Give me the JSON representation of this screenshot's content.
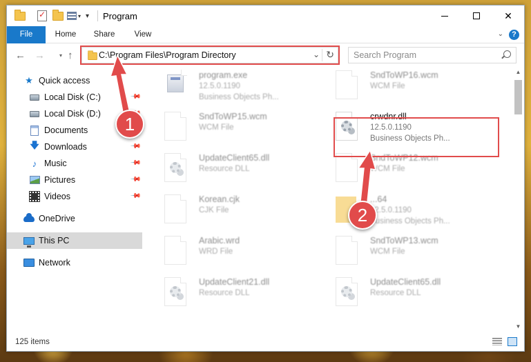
{
  "window": {
    "title": "Program",
    "minimize_glyph": "",
    "maximize_glyph": "",
    "close_glyph": "✕"
  },
  "ribbon": {
    "tabs": [
      "File",
      "Home",
      "Share",
      "View"
    ],
    "help": "?"
  },
  "navigation": {
    "back": "←",
    "forward": "→",
    "up": "↑",
    "address": "C:\\Program Files\\Program Directory",
    "search_placeholder": "Search Program"
  },
  "sidebar": {
    "items": [
      {
        "label": "Quick access",
        "icon": "star-icon",
        "pinned": false
      },
      {
        "label": "Local Disk (C:)",
        "icon": "disk-icon",
        "pinned": true
      },
      {
        "label": "Local Disk (D:)",
        "icon": "disk-icon",
        "pinned": true
      },
      {
        "label": "Documents",
        "icon": "documents-icon",
        "pinned": true
      },
      {
        "label": "Downloads",
        "icon": "download-icon",
        "pinned": true
      },
      {
        "label": "Music",
        "icon": "music-icon",
        "pinned": true
      },
      {
        "label": "Pictures",
        "icon": "pictures-icon",
        "pinned": true
      },
      {
        "label": "Videos",
        "icon": "videos-icon",
        "pinned": true
      },
      {
        "label": "OneDrive",
        "icon": "onedrive-icon",
        "pinned": false
      },
      {
        "label": "This PC",
        "icon": "pc-icon",
        "pinned": false,
        "selected": true
      },
      {
        "label": "Network",
        "icon": "network-icon",
        "pinned": false
      }
    ]
  },
  "files": [
    {
      "name": "program.exe",
      "line1": "12.5.0.1190",
      "line2": "Business Objects Ph...",
      "icon": "exe"
    },
    {
      "name": "SndToWP16.wcm",
      "line1": "WCM File",
      "line2": "",
      "icon": "doc"
    },
    {
      "name": "SndToWP15.wcm",
      "line1": "WCM File",
      "line2": "",
      "icon": "doc"
    },
    {
      "name": "crwdnr.dll",
      "line1": "12.5.0.1190",
      "line2": "Business Objects Ph...",
      "icon": "dll"
    },
    {
      "name": "UpdateClient65.dll",
      "line1": "Resource DLL",
      "line2": "",
      "icon": "dll"
    },
    {
      "name": "SndToWP12.wcm",
      "line1": "WCM File",
      "line2": "",
      "icon": "doc"
    },
    {
      "name": "Korean.cjk",
      "line1": "CJK File",
      "line2": "",
      "icon": "doc"
    },
    {
      "name": "...64",
      "line1": "12.5.0.1190",
      "line2": "Business Objects Ph...",
      "icon": "zip"
    },
    {
      "name": "Arabic.wrd",
      "line1": "WRD File",
      "line2": "",
      "icon": "doc"
    },
    {
      "name": "SndToWP13.wcm",
      "line1": "WCM File",
      "line2": "",
      "icon": "doc"
    },
    {
      "name": "UpdateClient21.dll",
      "line1": "Resource DLL",
      "line2": "",
      "icon": "dll"
    },
    {
      "name": "UpdateClient65.dll",
      "line1": "Resource DLL",
      "line2": "",
      "icon": "dll"
    }
  ],
  "status": {
    "item_count": "125 items"
  },
  "callouts": {
    "step1": "1",
    "step2": "2",
    "color": "#e14b4b"
  }
}
